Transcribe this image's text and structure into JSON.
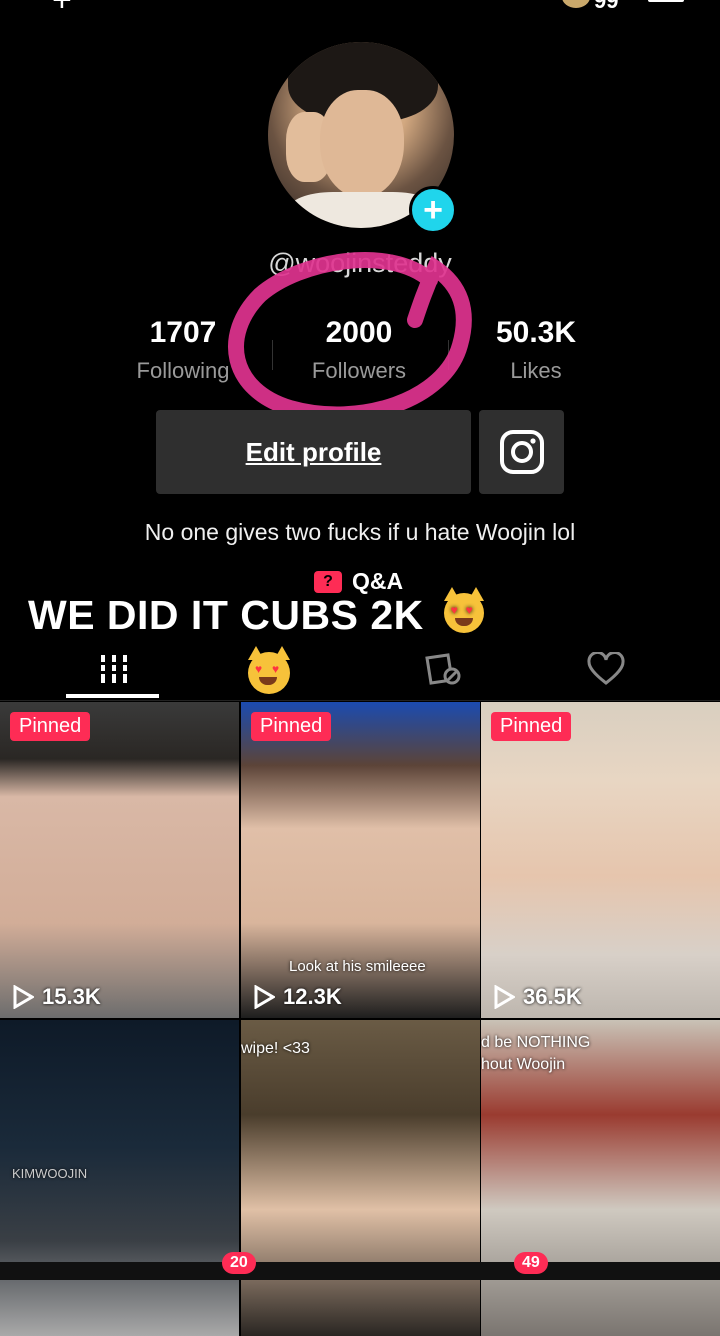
{
  "top": {
    "coin_count": "99"
  },
  "profile": {
    "username": "@woojinsteddy",
    "following_count": "1707",
    "following_label": "Following",
    "followers_count": "2000",
    "followers_label": "Followers",
    "likes_count": "50.3K",
    "likes_label": "Likes",
    "edit_profile_label": "Edit profile",
    "bio": "No one gives two fucks if u hate Woojin lol",
    "qa_label": "Q&A"
  },
  "overlay": {
    "caption": "WE DID IT CUBS 2K"
  },
  "tabs": [
    {
      "icon": "grid-icon"
    },
    {
      "icon": "lock-icon"
    },
    {
      "icon": "tagged-icon"
    },
    {
      "icon": "heart-icon"
    }
  ],
  "videos": [
    {
      "pinned": "Pinned",
      "views": "15.3K",
      "text": ""
    },
    {
      "pinned": "Pinned",
      "views": "12.3K",
      "text": "Look at his smileeee"
    },
    {
      "pinned": "Pinned",
      "views": "36.5K",
      "text": ""
    },
    {
      "pinned": "",
      "views": "",
      "text": "KIMWOOJIN"
    },
    {
      "pinned": "",
      "views": "",
      "text": "wipe! <33"
    },
    {
      "pinned": "",
      "views": "",
      "text": "d be NOTHING\nhout Woojin"
    }
  ],
  "bottom_nav": {
    "badge_1": "20",
    "badge_2": "49"
  },
  "colors": {
    "accent": "#fe2c55",
    "teal": "#20d5ec",
    "annotation": "#e0338f"
  }
}
